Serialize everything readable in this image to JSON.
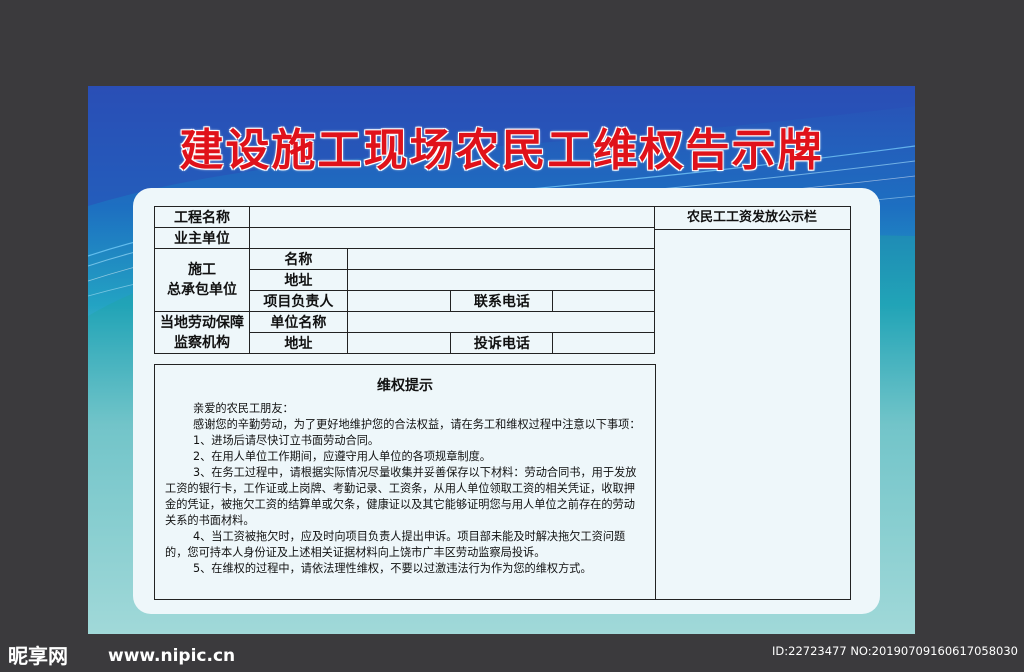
{
  "title": "建设施工现场农民工维权告示牌",
  "table": {
    "project_name": "工程名称",
    "owner_unit": "业主单位",
    "contractor": "施工\n总承包单位",
    "name": "名称",
    "address": "地址",
    "project_leader": "项目负责人",
    "contact_phone": "联系电话",
    "labor_office": "当地劳动保障\n监察机构",
    "unit_name": "单位名称",
    "address2": "地址",
    "complaint_phone": "投诉电话"
  },
  "wage_column": "农民工工资发放公示栏",
  "notice": {
    "heading": "维权提示",
    "paragraphs": [
      "亲爱的农民工朋友：",
      "感谢您的辛勤劳动，为了更好地维护您的合法权益，请在务工和维权过程中注意以下事项：",
      "1、进场后请尽快订立书面劳动合同。",
      "2、在用人单位工作期间，应遵守用人单位的各项规章制度。",
      "3、在务工过程中，请根据实际情况尽量收集并妥善保存以下材料：劳动合同书，用于发放工资的银行卡，工作证或上岗牌、考勤记录、工资条，从用人单位领取工资的相关凭证，收取押金的凭证，被拖欠工资的结算单或欠条，健康证以及其它能够证明您与用人单位之前存在的劳动关系的书面材料。",
      "4、当工资被拖欠时，应及时向项目负责人提出申诉。项目部未能及时解决拖欠工资问题的，您可持本人身份证及上述相关证据材料向上饶市广丰区劳动监察局投诉。",
      "5、在维权的过程中，请依法理性维权，不要以过激违法行为作为您的维权方式。"
    ]
  },
  "footer": {
    "logo": "昵享网",
    "url": "www.nipic.cn",
    "id": "ID:22723477 NO:20190709160617058030"
  },
  "colors": {
    "title": "#e0121a",
    "background": "#3b3a3d"
  }
}
